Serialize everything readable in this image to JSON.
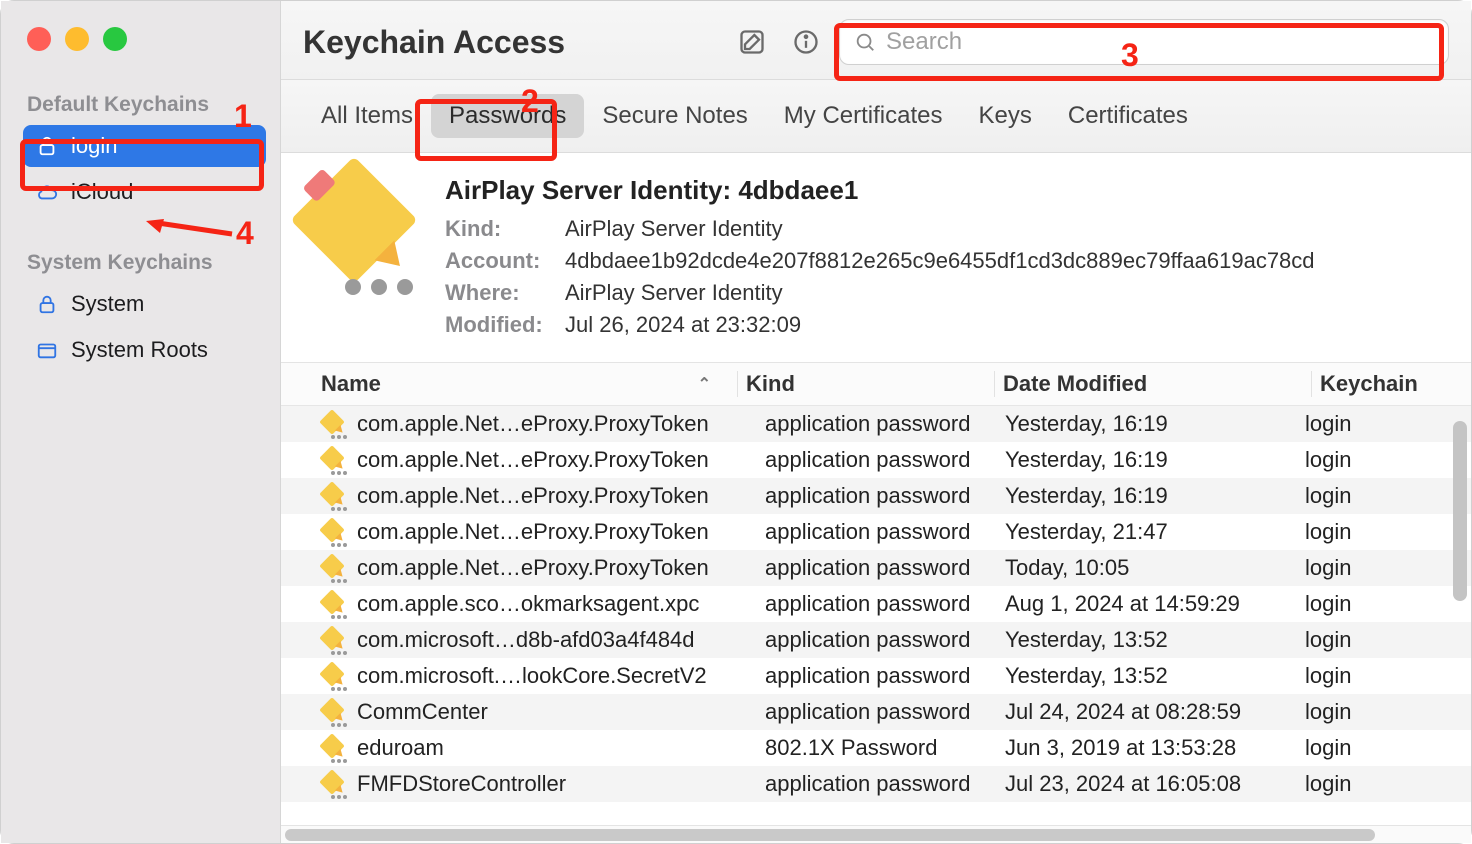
{
  "window": {
    "title": "Keychain Access"
  },
  "search": {
    "placeholder": "Search"
  },
  "annotations": {
    "labels": {
      "one": "1",
      "two": "2",
      "three": "3",
      "four": "4"
    }
  },
  "sidebar": {
    "sections": [
      {
        "title": "Default Keychains",
        "items": [
          {
            "label": "login",
            "icon": "unlock-icon",
            "selected": true
          },
          {
            "label": "iCloud",
            "icon": "cloud-icon",
            "selected": false
          }
        ]
      },
      {
        "title": "System Keychains",
        "items": [
          {
            "label": "System",
            "icon": "lock-icon",
            "selected": false
          },
          {
            "label": "System Roots",
            "icon": "folder-icon",
            "selected": false
          }
        ]
      }
    ]
  },
  "tabs": [
    {
      "label": "All Items",
      "selected": false
    },
    {
      "label": "Passwords",
      "selected": true
    },
    {
      "label": "Secure Notes",
      "selected": false
    },
    {
      "label": "My Certificates",
      "selected": false
    },
    {
      "label": "Keys",
      "selected": false
    },
    {
      "label": "Certificates",
      "selected": false
    }
  ],
  "detail": {
    "title": "AirPlay Server Identity: 4dbdaee1",
    "rows": [
      {
        "label": "Kind:",
        "value": "AirPlay Server Identity"
      },
      {
        "label": "Account:",
        "value": "4dbdaee1b92dcde4e207f8812e265c9e6455df1cd3dc889ec79ffaa619ac78cd"
      },
      {
        "label": "Where:",
        "value": "AirPlay Server Identity"
      },
      {
        "label": "Modified:",
        "value": "Jul 26, 2024 at 23:32:09"
      }
    ]
  },
  "columns": {
    "name": "Name",
    "kind": "Kind",
    "date": "Date Modified",
    "keychain": "Keychain"
  },
  "rows": [
    {
      "name": "com.apple.Net…eProxy.ProxyToken",
      "kind": "application password",
      "date": "Yesterday, 16:19",
      "keychain": "login"
    },
    {
      "name": "com.apple.Net…eProxy.ProxyToken",
      "kind": "application password",
      "date": "Yesterday, 16:19",
      "keychain": "login"
    },
    {
      "name": "com.apple.Net…eProxy.ProxyToken",
      "kind": "application password",
      "date": "Yesterday, 16:19",
      "keychain": "login"
    },
    {
      "name": "com.apple.Net…eProxy.ProxyToken",
      "kind": "application password",
      "date": "Yesterday, 21:47",
      "keychain": "login"
    },
    {
      "name": "com.apple.Net…eProxy.ProxyToken",
      "kind": "application password",
      "date": "Today, 10:05",
      "keychain": "login"
    },
    {
      "name": "com.apple.sco…okmarksagent.xpc",
      "kind": "application password",
      "date": "Aug 1, 2024 at 14:59:29",
      "keychain": "login"
    },
    {
      "name": "com.microsoft…d8b-afd03a4f484d",
      "kind": "application password",
      "date": "Yesterday, 13:52",
      "keychain": "login"
    },
    {
      "name": "com.microsoft.…lookCore.SecretV2",
      "kind": "application password",
      "date": "Yesterday, 13:52",
      "keychain": "login"
    },
    {
      "name": "CommCenter",
      "kind": "application password",
      "date": "Jul 24, 2024 at 08:28:59",
      "keychain": "login"
    },
    {
      "name": "eduroam",
      "kind": "802.1X Password",
      "date": "Jun 3, 2019 at 13:53:28",
      "keychain": "login"
    },
    {
      "name": "FMFDStoreController",
      "kind": "application password",
      "date": "Jul 23, 2024 at 16:05:08",
      "keychain": "login"
    }
  ]
}
